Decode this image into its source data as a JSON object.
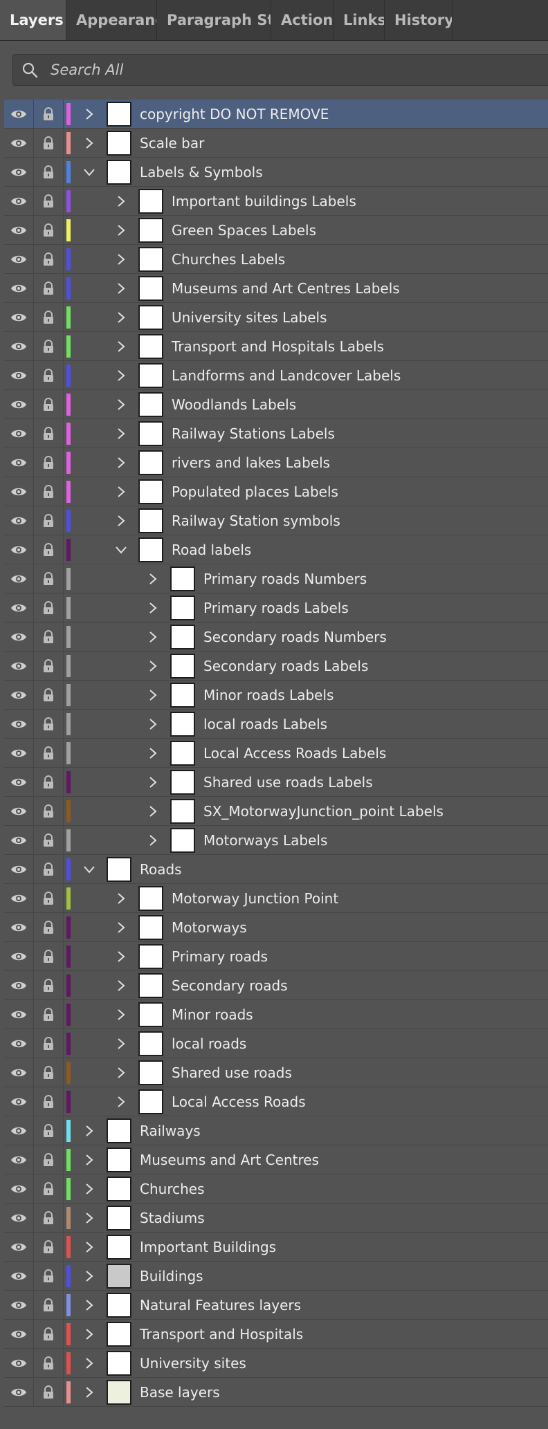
{
  "tabs": [
    {
      "label": "Layers",
      "active": true
    },
    {
      "label": "Appearance"
    },
    {
      "label": "Paragraph Styl"
    },
    {
      "label": "Actions"
    },
    {
      "label": "Links"
    },
    {
      "label": "History"
    }
  ],
  "search": {
    "placeholder": "Search All",
    "icon": "search-icon"
  },
  "colors": {
    "selected_row": "#4d6080",
    "panel": "#535353",
    "tabbar": "#3c3c3c"
  },
  "layers": [
    {
      "name": "copyright DO NOT REMOVE",
      "level": 0,
      "expanded": false,
      "color": "#e060e0",
      "selected": true,
      "thumb": "white"
    },
    {
      "name": "Scale bar",
      "level": 0,
      "expanded": false,
      "color": "#e89090",
      "thumb": "white"
    },
    {
      "name": "Labels & Symbols",
      "level": 0,
      "expanded": true,
      "color": "#5080e0",
      "thumb": "white"
    },
    {
      "name": "Important buildings Labels",
      "level": 1,
      "expanded": false,
      "color": "#9050e0",
      "thumb": "white"
    },
    {
      "name": "Green Spaces Labels",
      "level": 1,
      "expanded": false,
      "color": "#f0f060",
      "thumb": "white"
    },
    {
      "name": "Churches Labels",
      "level": 1,
      "expanded": false,
      "color": "#5050e0",
      "thumb": "white"
    },
    {
      "name": "Museums and Art Centres Labels",
      "level": 1,
      "expanded": false,
      "color": "#5050e0",
      "thumb": "white"
    },
    {
      "name": "University sites Labels",
      "level": 1,
      "expanded": false,
      "color": "#70e060",
      "thumb": "white"
    },
    {
      "name": "Transport and Hospitals Labels",
      "level": 1,
      "expanded": false,
      "color": "#70e060",
      "thumb": "white"
    },
    {
      "name": "Landforms and Landcover Labels",
      "level": 1,
      "expanded": false,
      "color": "#5050e0",
      "thumb": "white"
    },
    {
      "name": "Woodlands Labels",
      "level": 1,
      "expanded": false,
      "color": "#e060e0",
      "thumb": "white"
    },
    {
      "name": "Railway Stations Labels",
      "level": 1,
      "expanded": false,
      "color": "#e060e0",
      "thumb": "white"
    },
    {
      "name": "rivers and lakes Labels",
      "level": 1,
      "expanded": false,
      "color": "#e060e0",
      "thumb": "white"
    },
    {
      "name": "Populated places Labels",
      "level": 1,
      "expanded": false,
      "color": "#e060e0",
      "thumb": "white"
    },
    {
      "name": "Railway Station symbols",
      "level": 1,
      "expanded": false,
      "color": "#5050e0",
      "thumb": "white"
    },
    {
      "name": "Road labels",
      "level": 1,
      "expanded": true,
      "color": "#601860",
      "thumb": "white"
    },
    {
      "name": "Primary roads Numbers",
      "level": 2,
      "expanded": false,
      "color": "#a0a0a0",
      "thumb": "white"
    },
    {
      "name": "Primary roads Labels",
      "level": 2,
      "expanded": false,
      "color": "#a0a0a0",
      "thumb": "white"
    },
    {
      "name": "Secondary roads Numbers",
      "level": 2,
      "expanded": false,
      "color": "#a0a0a0",
      "thumb": "white"
    },
    {
      "name": "Secondary roads Labels",
      "level": 2,
      "expanded": false,
      "color": "#a0a0a0",
      "thumb": "white"
    },
    {
      "name": "Minor roads Labels",
      "level": 2,
      "expanded": false,
      "color": "#a0a0a0",
      "thumb": "white"
    },
    {
      "name": "local roads Labels",
      "level": 2,
      "expanded": false,
      "color": "#a0a0a0",
      "thumb": "white"
    },
    {
      "name": "Local Access Roads Labels",
      "level": 2,
      "expanded": false,
      "color": "#a0a0a0",
      "thumb": "white"
    },
    {
      "name": "Shared use roads Labels",
      "level": 2,
      "expanded": false,
      "color": "#601860",
      "thumb": "white"
    },
    {
      "name": "SX_MotorwayJunction_point Labels",
      "level": 2,
      "expanded": false,
      "color": "#8a5a20",
      "thumb": "white"
    },
    {
      "name": "Motorways Labels",
      "level": 2,
      "expanded": false,
      "color": "#a0a0a0",
      "thumb": "white"
    },
    {
      "name": "Roads",
      "level": 0,
      "expanded": true,
      "color": "#5050e0",
      "thumb": "white"
    },
    {
      "name": "Motorway Junction Point",
      "level": 1,
      "expanded": false,
      "color": "#a0c040",
      "thumb": "white"
    },
    {
      "name": "Motorways",
      "level": 1,
      "expanded": false,
      "color": "#601860",
      "thumb": "white"
    },
    {
      "name": "Primary roads",
      "level": 1,
      "expanded": false,
      "color": "#601860",
      "thumb": "white"
    },
    {
      "name": "Secondary roads",
      "level": 1,
      "expanded": false,
      "color": "#601860",
      "thumb": "white"
    },
    {
      "name": "Minor roads",
      "level": 1,
      "expanded": false,
      "color": "#601860",
      "thumb": "white"
    },
    {
      "name": "local roads",
      "level": 1,
      "expanded": false,
      "color": "#601860",
      "thumb": "white"
    },
    {
      "name": "Shared use roads",
      "level": 1,
      "expanded": false,
      "color": "#8a5a20",
      "thumb": "white"
    },
    {
      "name": "Local Access Roads",
      "level": 1,
      "expanded": false,
      "color": "#601860",
      "thumb": "white"
    },
    {
      "name": "Railways",
      "level": 0,
      "expanded": false,
      "color": "#70e0f0",
      "thumb": "white"
    },
    {
      "name": "Museums and Art Centres",
      "level": 0,
      "expanded": false,
      "color": "#70e060",
      "thumb": "white"
    },
    {
      "name": "Churches",
      "level": 0,
      "expanded": false,
      "color": "#70e060",
      "thumb": "white"
    },
    {
      "name": "Stadiums",
      "level": 0,
      "expanded": false,
      "color": "#b08a70",
      "thumb": "white"
    },
    {
      "name": "Important Buildings",
      "level": 0,
      "expanded": false,
      "color": "#e05050",
      "thumb": "white"
    },
    {
      "name": "Buildings",
      "level": 0,
      "expanded": false,
      "color": "#5050e0",
      "thumb": "gray"
    },
    {
      "name": "Natural Features layers",
      "level": 0,
      "expanded": false,
      "color": "#8090e0",
      "thumb": "white"
    },
    {
      "name": "Transport and Hospitals",
      "level": 0,
      "expanded": false,
      "color": "#e05050",
      "thumb": "white"
    },
    {
      "name": "University sites",
      "level": 0,
      "expanded": false,
      "color": "#e05050",
      "thumb": "white"
    },
    {
      "name": "Base layers",
      "level": 0,
      "expanded": false,
      "color": "#e89090",
      "thumb": "pale"
    }
  ]
}
